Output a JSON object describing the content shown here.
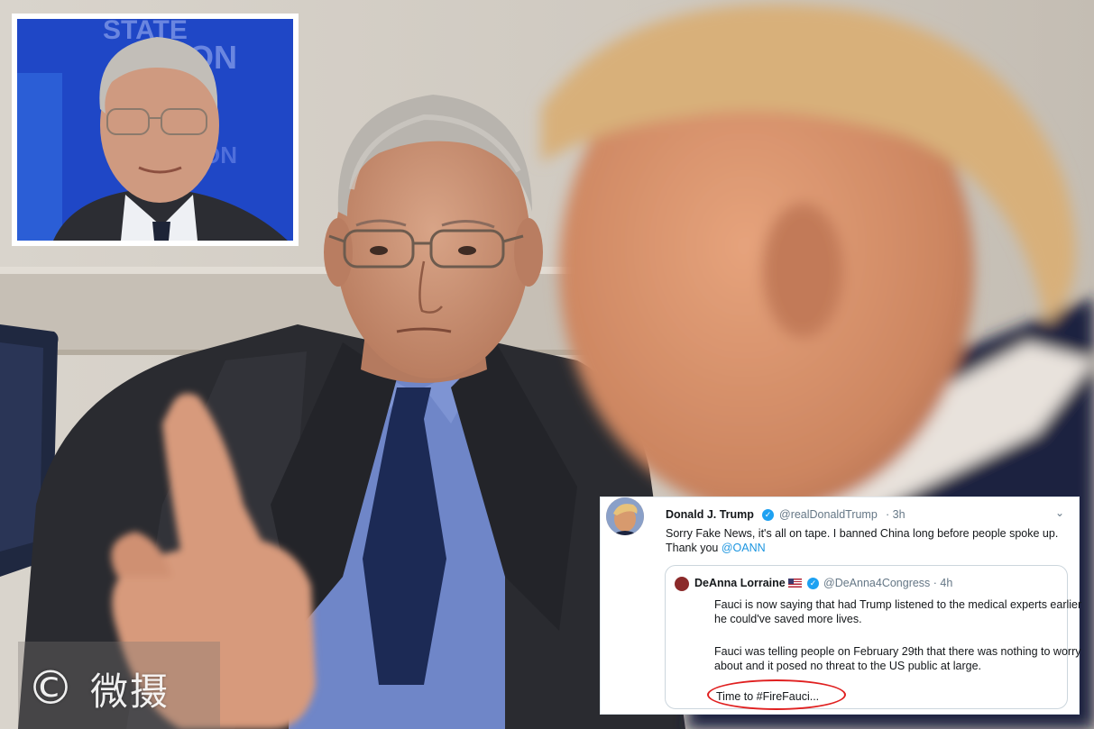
{
  "inset": {
    "background_text": [
      "STATE",
      "ON"
    ],
    "colors": {
      "backdrop": "#1e46c8",
      "frame": "#ffffff"
    }
  },
  "tweet": {
    "author": {
      "name": "Donald J. Trump",
      "handle": "@realDonaldTrump",
      "time": "· 3h",
      "verified_icon": "verified-check-icon"
    },
    "caret_icon": "chevron-down-icon",
    "text_main": "Sorry Fake News, it's all on tape. I banned China long before people spoke up. Thank you ",
    "mention": "@OANN",
    "quoted": {
      "name": "DeAnna Lorraine",
      "handle": "@DeAnna4Congress",
      "time": "· 4h",
      "flag_icon": "us-flag-icon",
      "paragraph1": "Fauci is now saying that had Trump listened to the medical experts earlier he could've saved more lives.",
      "paragraph2": "Fauci was telling people on February 29th that there was nothing to worry about and it posed no threat to the US public at large.",
      "paragraph3": "Time to #FireFauci..."
    },
    "colors": {
      "link": "#1b95e0",
      "verified": "#1da1f2",
      "highlight_circle": "#e02020"
    }
  },
  "watermark": {
    "symbol": "©",
    "text": "微摄"
  }
}
